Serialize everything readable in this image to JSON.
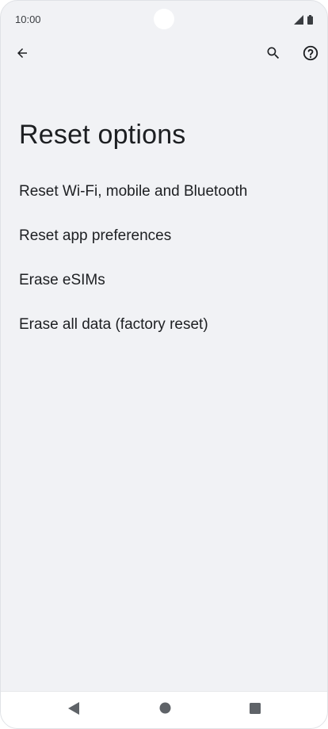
{
  "status_bar": {
    "time": "10:00",
    "icons": [
      "signal-icon",
      "battery-icon"
    ]
  },
  "app_bar": {
    "icons": [
      "arrow-back-icon",
      "search-icon",
      "help-icon"
    ]
  },
  "page": {
    "title": "Reset options"
  },
  "options": [
    {
      "label": "Reset Wi-Fi, mobile and Bluetooth"
    },
    {
      "label": "Reset app preferences"
    },
    {
      "label": "Erase eSIMs"
    },
    {
      "label": "Erase all data (factory reset)"
    }
  ],
  "nav_bar": {
    "icons": [
      "nav-back-icon",
      "nav-home-icon",
      "nav-recents-icon"
    ]
  },
  "colors": {
    "background": "#f1f2f5",
    "text": "#1d1f22",
    "icon": "#3a3d41",
    "nav_icon": "#5f6368"
  }
}
